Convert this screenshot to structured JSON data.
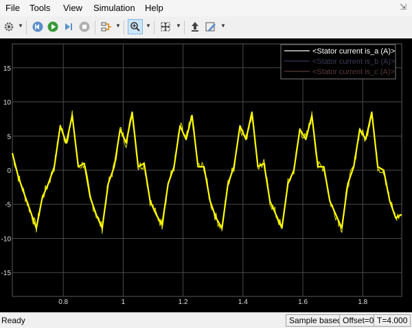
{
  "menu": [
    "File",
    "Tools",
    "View",
    "Simulation",
    "Help"
  ],
  "toolbar": {
    "icons": [
      "gear-icon",
      "step-back-icon",
      "run-icon",
      "step-forward-icon",
      "stop-icon",
      "signal-select-icon",
      "zoom-in-icon",
      "fit-to-view-icon",
      "highlight-block-icon",
      "style-icon"
    ]
  },
  "chart_data": {
    "type": "line",
    "xlim": [
      0.63,
      1.93
    ],
    "ylim": [
      -18.5,
      18.5
    ],
    "xticks": [
      0.8,
      1.0,
      1.2,
      1.4,
      1.6,
      1.8
    ],
    "xtick_labels": [
      "0.8",
      "1",
      "1.2",
      "1.4",
      "1.6",
      "1.8"
    ],
    "yticks": [
      15,
      10,
      5,
      0,
      -5,
      -10,
      -15
    ],
    "ytick_labels": [
      "15",
      "10",
      "5",
      "0",
      "-5",
      "-10",
      "-15"
    ],
    "grid": true,
    "background": "#000000",
    "legend_position": "top-right",
    "legend": [
      {
        "label": "<Stator current is_a (A)>",
        "color": "#ffffff"
      },
      {
        "label": "<Stator current is_b (A)>",
        "color": "#3a3a5a"
      },
      {
        "label": "<Stator current is_c (A)>",
        "color": "#5a3a3a"
      }
    ],
    "series": [
      {
        "name": "<Stator current is_a (A)>",
        "color": "#ffff00",
        "x": [
          0.63,
          0.65,
          0.67,
          0.69,
          0.71,
          0.73,
          0.75,
          0.77,
          0.79,
          0.81,
          0.83,
          0.85,
          0.87,
          0.89,
          0.91,
          0.93,
          0.95,
          0.97,
          0.99,
          1.01,
          1.03,
          1.05,
          1.07,
          1.09,
          1.11,
          1.13,
          1.15,
          1.17,
          1.19,
          1.21,
          1.23,
          1.25,
          1.27,
          1.29,
          1.31,
          1.33,
          1.35,
          1.37,
          1.39,
          1.41,
          1.43,
          1.45,
          1.47,
          1.49,
          1.51,
          1.53,
          1.55,
          1.57,
          1.59,
          1.61,
          1.63,
          1.65,
          1.67,
          1.69,
          1.71,
          1.73,
          1.75,
          1.77,
          1.79,
          1.81,
          1.83,
          1.85,
          1.87,
          1.89,
          1.91,
          1.93
        ],
        "y": [
          2.5,
          -1.0,
          -3.5,
          -6.0,
          -8.5,
          -4.0,
          -2.0,
          0.5,
          6.5,
          4.0,
          8.0,
          0.5,
          1.0,
          -4.0,
          -6.5,
          -8.5,
          -2.0,
          0.5,
          6.0,
          4.0,
          8.5,
          0.5,
          1.0,
          -4.5,
          -6.5,
          -8.0,
          -2.0,
          0.5,
          6.5,
          4.5,
          8.0,
          0.5,
          0.5,
          -4.5,
          -7.0,
          -8.5,
          -2.0,
          0.5,
          6.5,
          4.5,
          8.5,
          0.5,
          1.0,
          -4.5,
          -6.5,
          -8.5,
          -2.0,
          0.0,
          6.0,
          4.5,
          8.0,
          0.5,
          0.5,
          -4.5,
          -6.5,
          -8.5,
          -2.0,
          0.5,
          6.0,
          4.5,
          8.5,
          0.5,
          0.0,
          -4.5,
          -7.0,
          -6.5
        ]
      }
    ]
  },
  "status": {
    "ready": "Ready",
    "mode": "Sample based",
    "offset": "Offset=0",
    "time": "T=4.000"
  }
}
